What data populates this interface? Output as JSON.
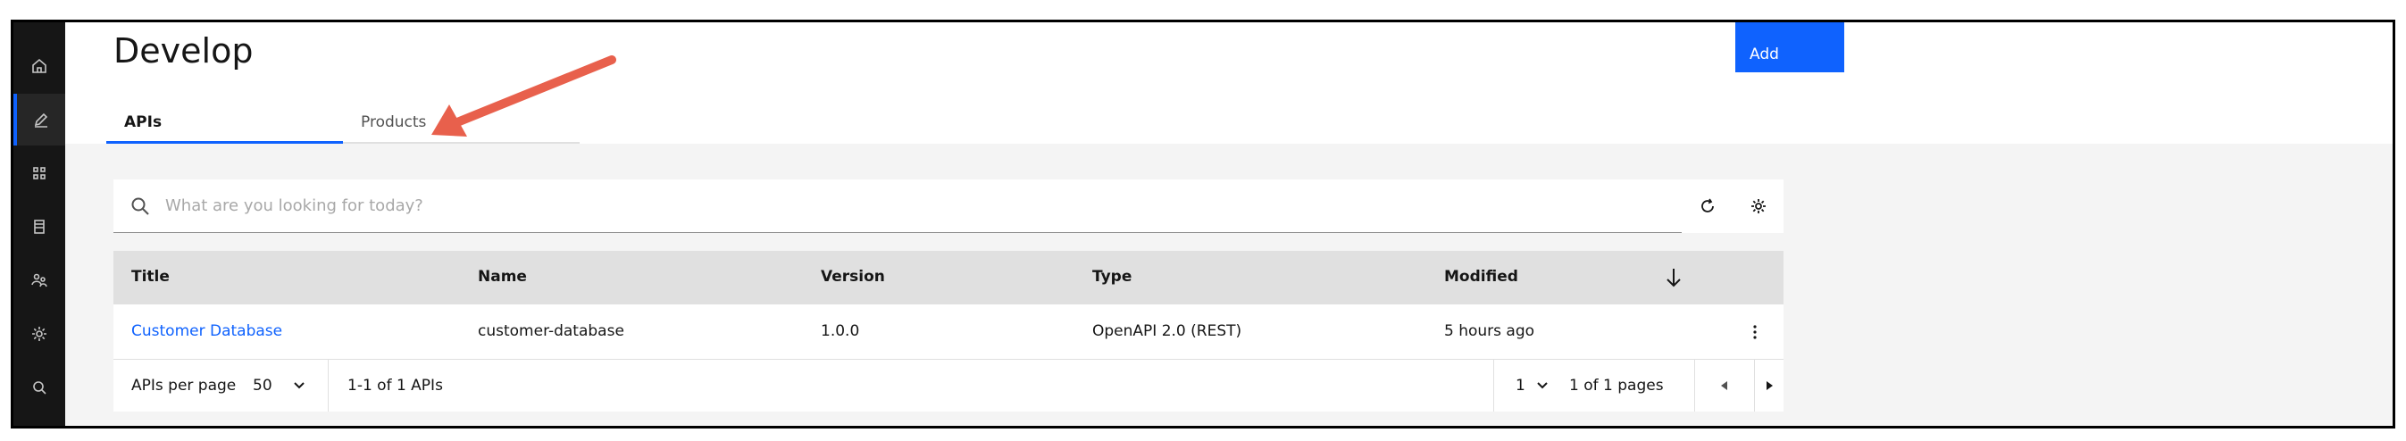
{
  "page": {
    "title": "Develop",
    "add_label": "Add"
  },
  "tabs": [
    {
      "label": "APIs",
      "active": true
    },
    {
      "label": "Products",
      "active": false
    }
  ],
  "sidebar": {
    "items": [
      {
        "icon": "home-icon"
      },
      {
        "icon": "edit-icon",
        "active": true
      },
      {
        "icon": "grid-icon"
      },
      {
        "icon": "catalog-icon"
      },
      {
        "icon": "users-icon"
      },
      {
        "icon": "settings-icon"
      },
      {
        "icon": "search-icon"
      }
    ]
  },
  "search": {
    "placeholder": "What are you looking for today?"
  },
  "table": {
    "columns": [
      "Title",
      "Name",
      "Version",
      "Type",
      "Modified"
    ],
    "rows": [
      {
        "title": "Customer Database",
        "name": "customer-database",
        "version": "1.0.0",
        "type": "OpenAPI 2.0 (REST)",
        "modified": "5 hours ago"
      }
    ]
  },
  "pagination": {
    "per_page_label": "APIs per page",
    "per_page_value": "50",
    "range": "1-1 of 1 APIs",
    "page_value": "1",
    "pages_label": "1 of 1 pages"
  },
  "colors": {
    "accent": "#0f62fe",
    "annotation_arrow": "#e8604c",
    "rail": "#161616"
  }
}
